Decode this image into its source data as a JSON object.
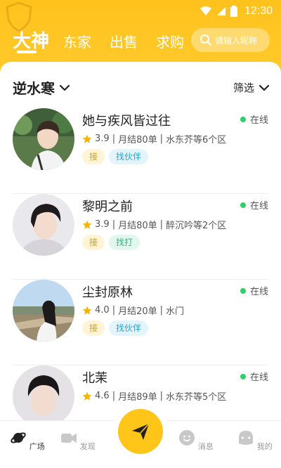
{
  "status": {
    "time": "12:30"
  },
  "tabs": [
    {
      "label": "大神"
    },
    {
      "label": "东家"
    },
    {
      "label": "出售"
    },
    {
      "label": "求购"
    }
  ],
  "search": {
    "placeholder": "请输入昵称"
  },
  "filter_bar": {
    "location": "逆水寒",
    "filter_label": "筛选"
  },
  "users": [
    {
      "name": "她与疾风皆过往",
      "status": "在线",
      "rating": "3.9",
      "monthly": "月结80单",
      "area": "水东芥等6个区",
      "tags": [
        {
          "label": "接",
          "color": "yellow"
        },
        {
          "label": "找伙伴",
          "color": "blue"
        }
      ]
    },
    {
      "name": "黎明之前",
      "status": "在线",
      "rating": "3.9",
      "monthly": "月结80单",
      "area": "醉沉吟等2个区",
      "tags": [
        {
          "label": "接",
          "color": "yellow"
        },
        {
          "label": "找打",
          "color": "green"
        }
      ]
    },
    {
      "name": "尘封原林",
      "status": "在线",
      "rating": "4.0",
      "monthly": "月结20单",
      "area": "水门",
      "tags": [
        {
          "label": "接",
          "color": "yellow"
        },
        {
          "label": "找伙伴",
          "color": "blue"
        }
      ]
    },
    {
      "name": "北茉",
      "status": "在线",
      "rating": "4.6",
      "monthly": "月结89单",
      "area": "水东芥等5个区",
      "tags": []
    }
  ],
  "bottom_nav": [
    {
      "label": "广场",
      "icon": "planet-icon",
      "active": true
    },
    {
      "label": "发现",
      "icon": "camera-icon",
      "active": false
    },
    {
      "label": "消息",
      "icon": "message-icon",
      "active": false
    },
    {
      "label": "我的",
      "icon": "profile-icon",
      "active": false
    }
  ],
  "colors": {
    "brand": "#ffc21c",
    "online": "#2fcf6a"
  }
}
